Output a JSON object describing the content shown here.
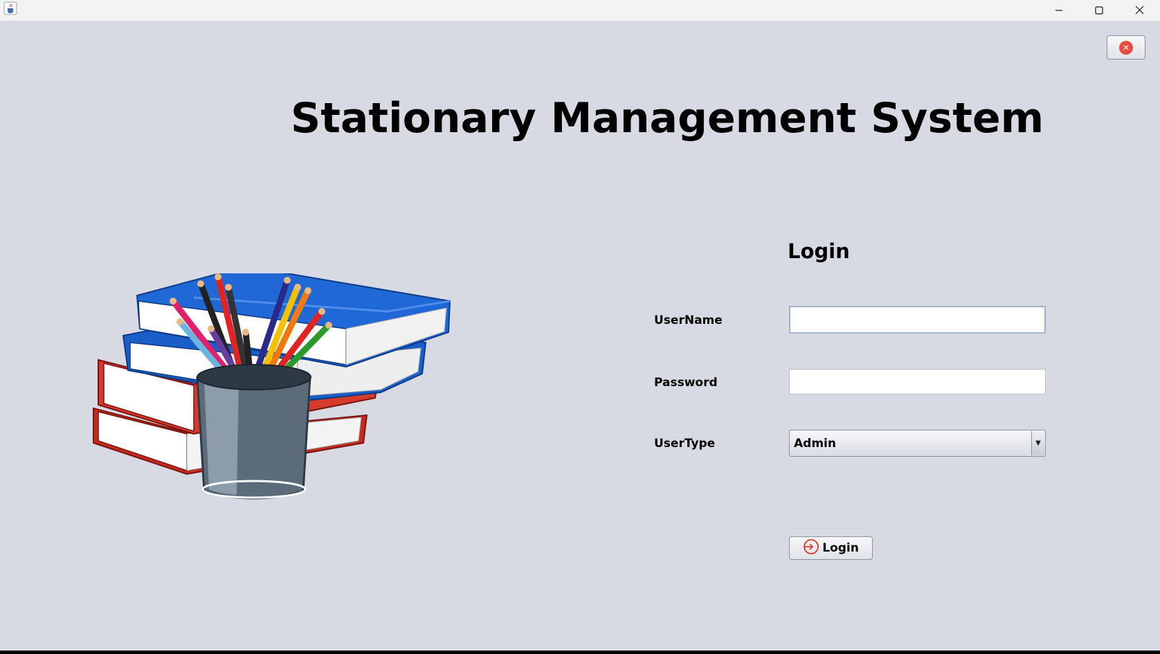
{
  "window": {
    "app_icon": "java-cup-icon",
    "controls": {
      "minimize": "minimize-icon",
      "maximize": "maximize-icon",
      "close": "close-icon"
    }
  },
  "toolbar": {
    "exit_icon": "close-circle-icon",
    "exit_color": "#e94b3c"
  },
  "app_title": "Stationary Management System",
  "illustration": "books-and-pencil-cup",
  "login": {
    "heading": "Login",
    "username_label": "UserName",
    "username_value": "",
    "password_label": "Password",
    "password_value": "",
    "usertype_label": "UserType",
    "usertype_selected": "Admin",
    "submit_label": "Login",
    "submit_icon": "login-arrow-icon",
    "accent_color": "#e2362a"
  },
  "colors": {
    "background": "#d7dae2",
    "blue_book": "#1a5fc7",
    "red_book": "#d63a2a"
  }
}
